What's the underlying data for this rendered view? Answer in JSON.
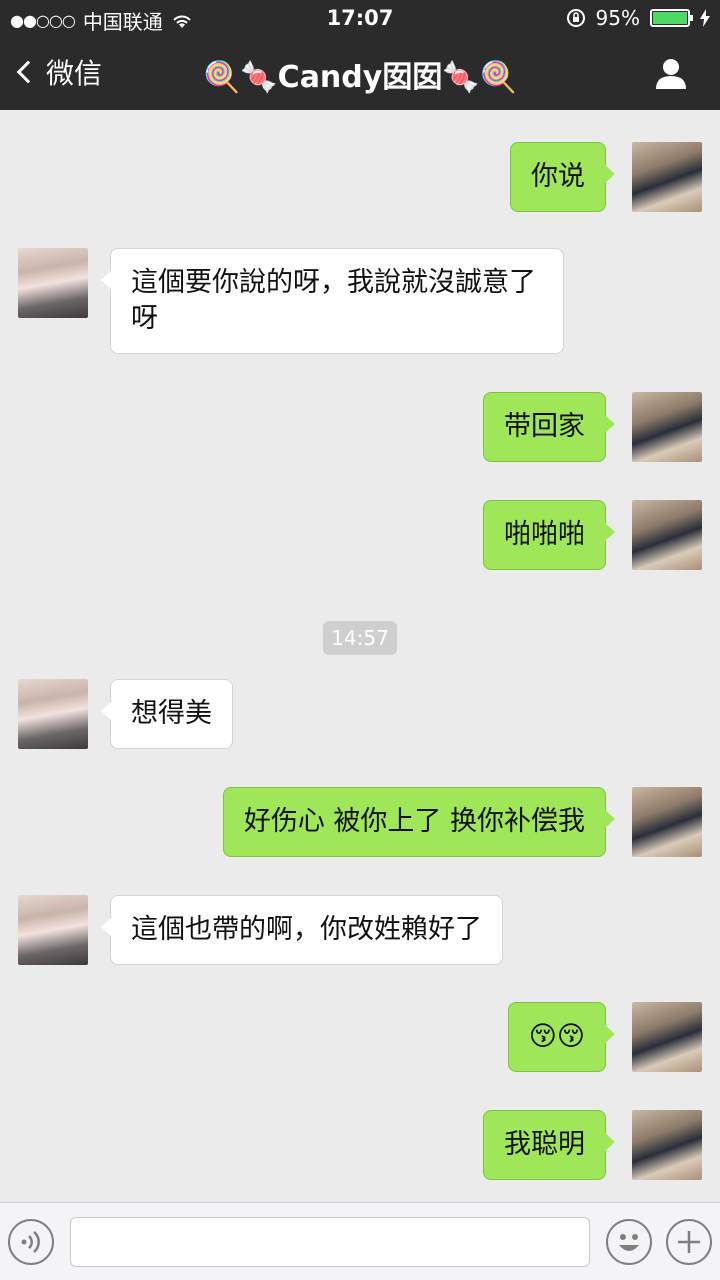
{
  "status_bar": {
    "signal": "●●○○○",
    "carrier": "中国联通",
    "time": "17:07",
    "battery_text": "95%",
    "battery_level": 0.95
  },
  "nav": {
    "back_label": "微信",
    "title": "🍭🍬Candy囡囡🍬🍭"
  },
  "messages": [
    {
      "side": "right",
      "text": "你说"
    },
    {
      "side": "left",
      "text": "這個要你說的呀，我說就沒誠意了\n呀"
    },
    {
      "side": "right",
      "text": "带回家"
    },
    {
      "side": "right",
      "text": "啪啪啪"
    },
    {
      "side": "left",
      "text": "想得美"
    },
    {
      "side": "right",
      "text": "好伤心 被你上了 换你补偿我"
    },
    {
      "side": "left",
      "text": "這個也帶的啊，你改姓賴好了"
    },
    {
      "side": "right",
      "text": "😚😚"
    },
    {
      "side": "right",
      "text": "我聪明"
    }
  ],
  "timestamp": "14:57",
  "input": {
    "value": "",
    "placeholder": ""
  },
  "icons": {
    "voice": "voice-icon",
    "emoji": "emoji-icon",
    "plus": "plus-icon",
    "profile": "profile-icon",
    "wifi": "wifi-icon",
    "lock": "rotation-lock-icon",
    "charging": "charging-icon"
  },
  "colors": {
    "nav_bg": "#2b2b2b",
    "bubble_self": "#9fe658",
    "bubble_other": "#ffffff",
    "chat_bg": "#ebebeb"
  }
}
